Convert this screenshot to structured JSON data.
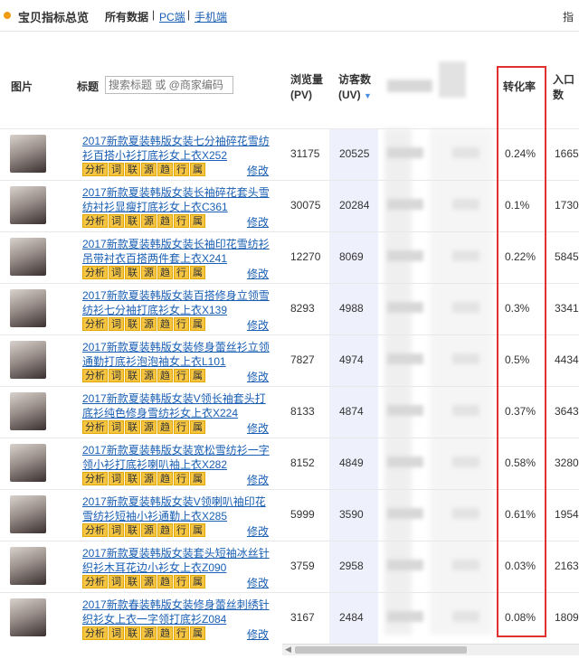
{
  "header": {
    "title": "宝贝指标总览",
    "nav_all": "所有数据",
    "nav_pc": "PC端",
    "nav_mobile": "手机端",
    "right_label": "指"
  },
  "columns": {
    "image": "图片",
    "title": "标题",
    "search_placeholder": "搜索标题 或 @商家编码",
    "pv": "浏览量(PV)",
    "uv": "访客数(UV)",
    "conversion": "转化率",
    "entry": "入口数"
  },
  "tags": [
    "分析",
    "词",
    "联",
    "源",
    "趋",
    "行",
    "属"
  ],
  "edit_label": "修改",
  "rows": [
    {
      "title": "2017新款夏装韩版女装七分袖碎花雪纺衫百搭小衫打底衫女上衣X252",
      "pv": "31175",
      "uv": "20525",
      "conversion": "0.24%",
      "entry": "1665"
    },
    {
      "title": "2017新款夏装韩版女装长袖碎花套头雪纺衬衫显瘦打底衫女上衣C361",
      "pv": "30075",
      "uv": "20284",
      "conversion": "0.1%",
      "entry": "1730"
    },
    {
      "title": "2017新款夏装韩版女装长袖印花雪纺衫吊带衬衣百搭两件套上衣X241",
      "pv": "12270",
      "uv": "8069",
      "conversion": "0.22%",
      "entry": "5845"
    },
    {
      "title": "2017新款夏装韩版女装百搭修身立领雪纺衫七分袖打底衫女上衣X139",
      "pv": "8293",
      "uv": "4988",
      "conversion": "0.3%",
      "entry": "3341"
    },
    {
      "title": "2017新款夏装韩版女装修身蕾丝衫立领通勤打底衫泡泡袖女上衣L101",
      "pv": "7827",
      "uv": "4974",
      "conversion": "0.5%",
      "entry": "4434"
    },
    {
      "title": "2017新款夏装韩版女装V领长袖套头打底衫纯色修身雪纺衫女上衣X224",
      "pv": "8133",
      "uv": "4874",
      "conversion": "0.37%",
      "entry": "3643"
    },
    {
      "title": "2017新款夏装韩版女装宽松雪纺衫一字领小衫打底衫喇叭袖上衣X282",
      "pv": "8152",
      "uv": "4849",
      "conversion": "0.58%",
      "entry": "3280"
    },
    {
      "title": "2017新款夏装韩版女装V领喇叭袖印花雪纺衫短袖小衫通勤上衣X285",
      "pv": "5999",
      "uv": "3590",
      "conversion": "0.61%",
      "entry": "1954"
    },
    {
      "title": "2017新款夏装韩版女装套头短袖冰丝针织衫木耳花边小衫女上衣Z090",
      "pv": "3759",
      "uv": "2958",
      "conversion": "0.03%",
      "entry": "2163"
    },
    {
      "title": "2017新款春装韩版女装修身蕾丝刺绣针织衫女上衣一字领打底衫Z084",
      "pv": "3167",
      "uv": "2484",
      "conversion": "0.08%",
      "entry": "1809"
    }
  ],
  "colors": {
    "highlight_box": "#e0312f",
    "link": "#1a5fb4",
    "tag_bg": "#f5c542"
  }
}
